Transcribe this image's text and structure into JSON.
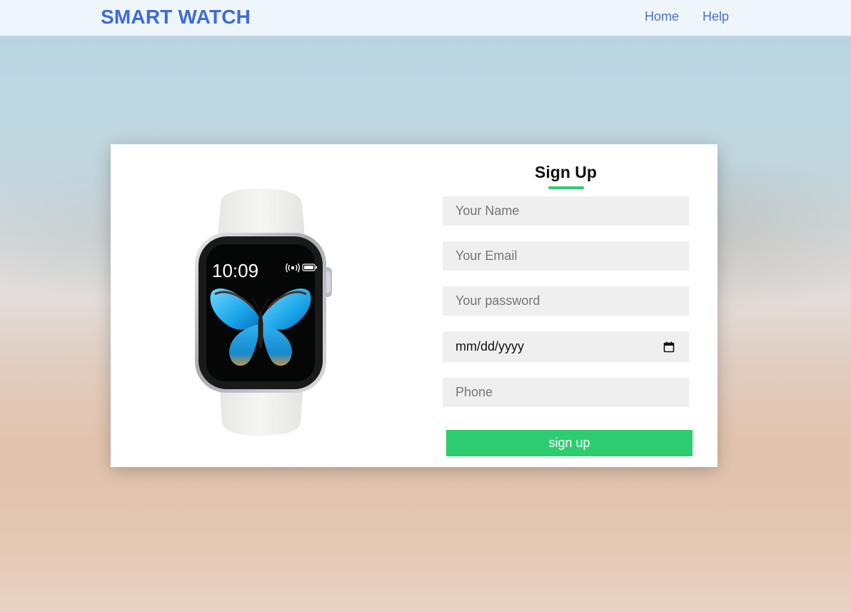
{
  "navbar": {
    "brand": "SMART WATCH",
    "links": [
      "Home",
      "Help"
    ]
  },
  "form": {
    "title": "Sign Up",
    "name_placeholder": "Your Name",
    "email_placeholder": "Your Email",
    "password_placeholder": "Your password",
    "date_value": "mm/dd/yyyy",
    "phone_placeholder": "Phone",
    "submit_label": "sign up"
  },
  "watch": {
    "time": "10:09"
  },
  "colors": {
    "brand": "#3f6ad8",
    "nav_link": "#4a6fc9",
    "accent": "#2ecc71",
    "field_bg": "#efefef",
    "navbar_bg": "#eef6fc"
  },
  "icons": {
    "date_picker": "calendar-icon",
    "watch_status": [
      "wireless-icon",
      "battery-icon"
    ]
  }
}
